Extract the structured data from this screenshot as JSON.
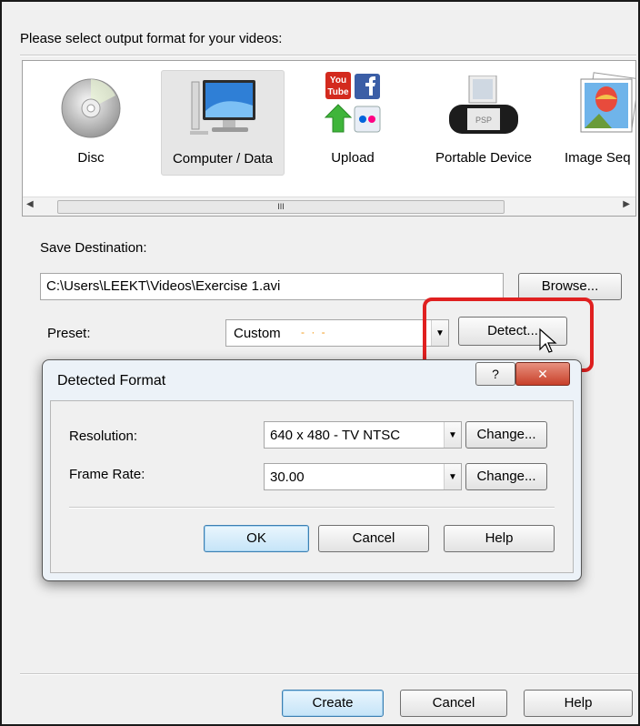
{
  "header": {
    "prompt": "Please select output format for your videos:"
  },
  "formats": [
    {
      "label": "Disc",
      "icon": "disc-icon"
    },
    {
      "label": "Computer / Data",
      "icon": "computer-icon",
      "selected": true
    },
    {
      "label": "Upload",
      "icon": "upload-icon"
    },
    {
      "label": "Portable Device",
      "icon": "psp-icon"
    },
    {
      "label": "Image Seq",
      "icon": "image-sequence-icon"
    }
  ],
  "scrollbar": {
    "thumb_grip": "III"
  },
  "youtube_icon": {
    "line1": "You",
    "line2": "Tube"
  },
  "psp_screen": "PSP",
  "save": {
    "label": "Save Destination:",
    "path": "C:\\Users\\LEEKT\\Videos\\Exercise 1.avi",
    "browse_label": "Browse..."
  },
  "preset": {
    "label": "Preset:",
    "value": "Custom",
    "detect_label": "Detect..."
  },
  "dialog": {
    "title": "Detected Format",
    "help_glyph": "?",
    "close_glyph": "✕",
    "resolution": {
      "label": "Resolution:",
      "value": "640 x 480 - TV NTSC",
      "change_label": "Change..."
    },
    "frame_rate": {
      "label": "Frame Rate:",
      "value": "30.00",
      "change_label": "Change..."
    },
    "ok_label": "OK",
    "cancel_label": "Cancel",
    "help_label": "Help"
  },
  "footer": {
    "create_label": "Create",
    "cancel_label": "Cancel",
    "help_label": "Help"
  },
  "colors": {
    "highlight": "#e02020",
    "default_button": "#3c7fb1"
  }
}
